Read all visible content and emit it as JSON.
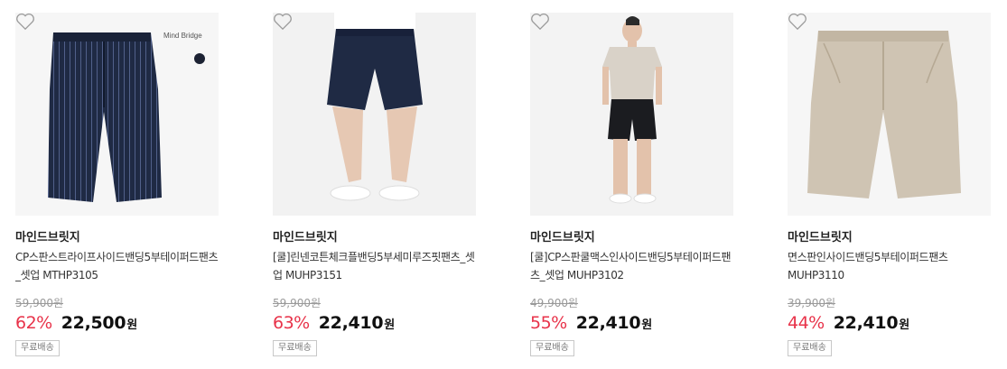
{
  "products": [
    {
      "brand": "마인드브릿지",
      "name": "CP스판스트라이프사이드밴딩5부테이퍼드팬츠_셋업 MTHP3105",
      "original_price": "59,900원",
      "discount_rate": "62%",
      "price": "22,500",
      "currency": "원",
      "shipping": "무료배송",
      "overlay_text": "Mind Bridge",
      "image": "navy-pinstripe-shorts",
      "wishlist_icon": "heart-outline-icon"
    },
    {
      "brand": "마인드브릿지",
      "name": "[쿨]린넨코튼체크플밴딩5부세미루즈핏팬츠_셋업 MUHP3151",
      "original_price": "59,900원",
      "discount_rate": "63%",
      "price": "22,410",
      "currency": "원",
      "shipping": "무료배송",
      "image": "model-legs-navy-shorts",
      "wishlist_icon": "heart-outline-icon"
    },
    {
      "brand": "마인드브릿지",
      "name": "[쿨]CP스판쿨맥스인사이드밴딩5부테이퍼드팬츠_셋업 MUHP3102",
      "original_price": "49,900원",
      "discount_rate": "55%",
      "price": "22,410",
      "currency": "원",
      "shipping": "무료배송",
      "image": "model-full-body-black-shorts",
      "wishlist_icon": "heart-outline-icon"
    },
    {
      "brand": "마인드브릿지",
      "name": "면스판인사이드밴딩5부테이퍼드팬츠 MUHP3110",
      "original_price": "39,900원",
      "discount_rate": "44%",
      "price": "22,410",
      "currency": "원",
      "shipping": "무료배송",
      "image": "beige-shorts",
      "wishlist_icon": "heart-outline-icon"
    }
  ],
  "colors": {
    "discount": "#e8334a",
    "strike": "#999999",
    "navy": "#1f2a44",
    "black": "#1b1c20",
    "beige": "#cfc4b3"
  }
}
